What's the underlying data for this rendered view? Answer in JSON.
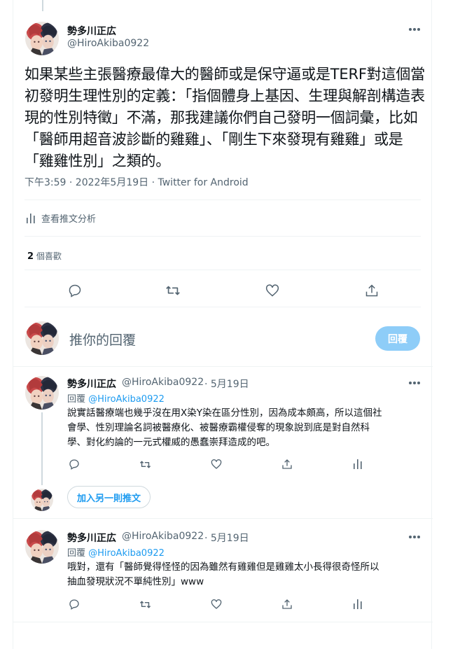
{
  "main_tweet": {
    "author_name": "勢多川正広",
    "author_handle": "@HiroAkiba0922",
    "text": "如果某些主張醫療最偉大的醫師或是保守逼或是TERF對這個當初發明生理性別的定義：「指個體身上基因、生理與解剖構造表現的性別特徵」不滿，那我建議你們自己發明一個詞彙，比如「醫師用超音波診斷的雞雞」、「剛生下來發現有雞雞」或是「雞雞性別」之類的。",
    "meta": "下午3:59 · 2022年5月19日 · Twitter for Android",
    "analytics_label": "查看推文分析",
    "likes_count": "2",
    "likes_label": "個喜歡"
  },
  "composer": {
    "placeholder": "推你的回覆",
    "button_label": "回覆"
  },
  "replies": [
    {
      "author_name": "勢多川正広",
      "author_handle": "@HiroAkiba0922",
      "date": "· 5月19日",
      "reply_prefix": "回覆",
      "reply_to": "@HiroAkiba0922",
      "lines": [
        "說實話醫療端也幾乎沒在用X染Y染在區分性別，因為成本頗高，所以這個社",
        "會學、性別理論名詞被醫療化、被醫療霸權侵奪的現象說到底是對自然科",
        "學、對化約論的一元式權威的愚蠢崇拜造成的吧。"
      ]
    },
    {
      "author_name": "勢多川正広",
      "author_handle": "@HiroAkiba0922",
      "date": "· 5月19日",
      "reply_prefix": "回覆",
      "reply_to": "@HiroAkiba0922",
      "lines": [
        "哦對，還有「醫師覺得怪怪的因為雖然有雞雞但是雞雞太小長得很奇怪所以",
        "抽血發現狀況不單純性別」www"
      ]
    }
  ],
  "add_tweet_label": "加入另一則推文",
  "icons": {
    "reply": "reply-icon",
    "retweet": "retweet-icon",
    "like": "heart-icon",
    "share": "share-icon",
    "analytics": "analytics-icon",
    "more": "more-icon"
  },
  "colors": {
    "accent": "#1d9bf0",
    "reply_button_disabled": "#8ecdf8",
    "secondary_text": "#536471",
    "thread_line": "#cfd9de",
    "divider": "#eff3f4"
  }
}
